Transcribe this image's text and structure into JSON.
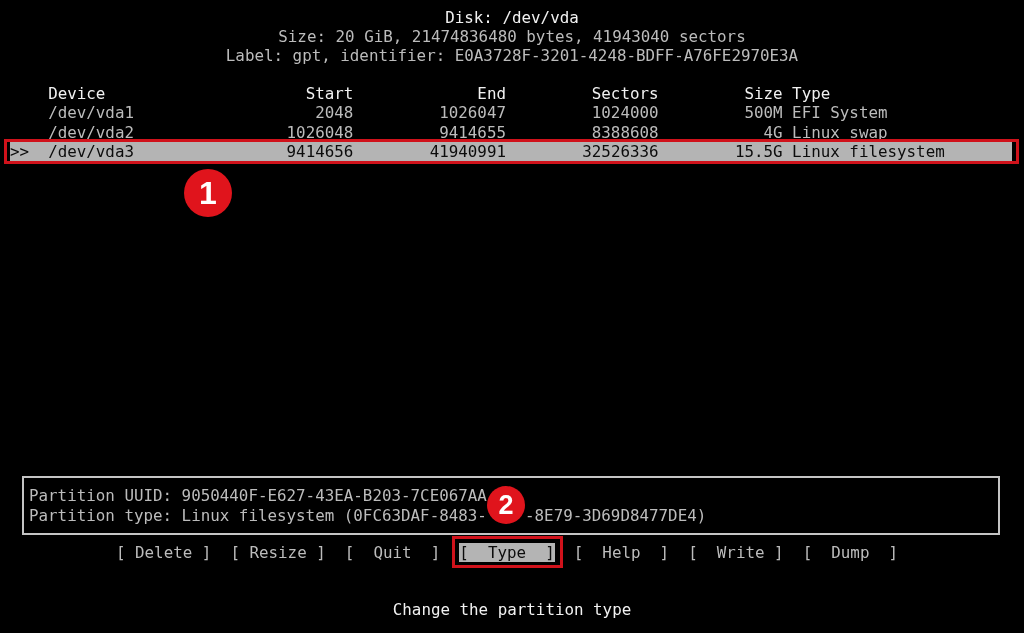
{
  "header": {
    "title": "Disk: /dev/vda",
    "size_line": "Size: 20 GiB, 21474836480 bytes, 41943040 sectors",
    "label_line": "Label: gpt, identifier: E0A3728F-3201-4248-BDFF-A76FE2970E3A"
  },
  "table": {
    "cursor": ">>",
    "columns": [
      "Device",
      "Start",
      "End",
      "Sectors",
      "Size",
      "Type"
    ],
    "rows": [
      {
        "device": "/dev/vda1",
        "start": "2048",
        "end": "1026047",
        "sectors": "1024000",
        "size": "500M",
        "type": "EFI System",
        "selected": false
      },
      {
        "device": "/dev/vda2",
        "start": "1026048",
        "end": "9414655",
        "sectors": "8388608",
        "size": "4G",
        "type": "Linux swap",
        "selected": false
      },
      {
        "device": "/dev/vda3",
        "start": "9414656",
        "end": "41940991",
        "sectors": "32526336",
        "size": "15.5G",
        "type": "Linux filesystem",
        "selected": true,
        "callout": "1"
      }
    ]
  },
  "partition_info": {
    "lines": [
      {
        "parts": [
          "Partition UUID: 9050440F-E627-43EA-B203-7CE067AA"
        ]
      },
      {
        "parts": [
          "Partition type: Linux filesystem (0FC63DAF-8483-",
          "-8E79-3D69D8477DE4)"
        ]
      }
    ]
  },
  "actions": [
    {
      "label": "[ Delete ]",
      "selected": false
    },
    {
      "label": "[ Resize ]",
      "selected": false
    },
    {
      "label": "[  Quit  ]",
      "selected": false
    },
    {
      "label": "[  Type  ]",
      "selected": true,
      "callout": "2"
    },
    {
      "label": "[  Help  ]",
      "selected": false
    },
    {
      "label": "[  Write ]",
      "selected": false
    },
    {
      "label": "[  Dump  ]",
      "selected": false
    }
  ],
  "hint": "Change the partition type"
}
